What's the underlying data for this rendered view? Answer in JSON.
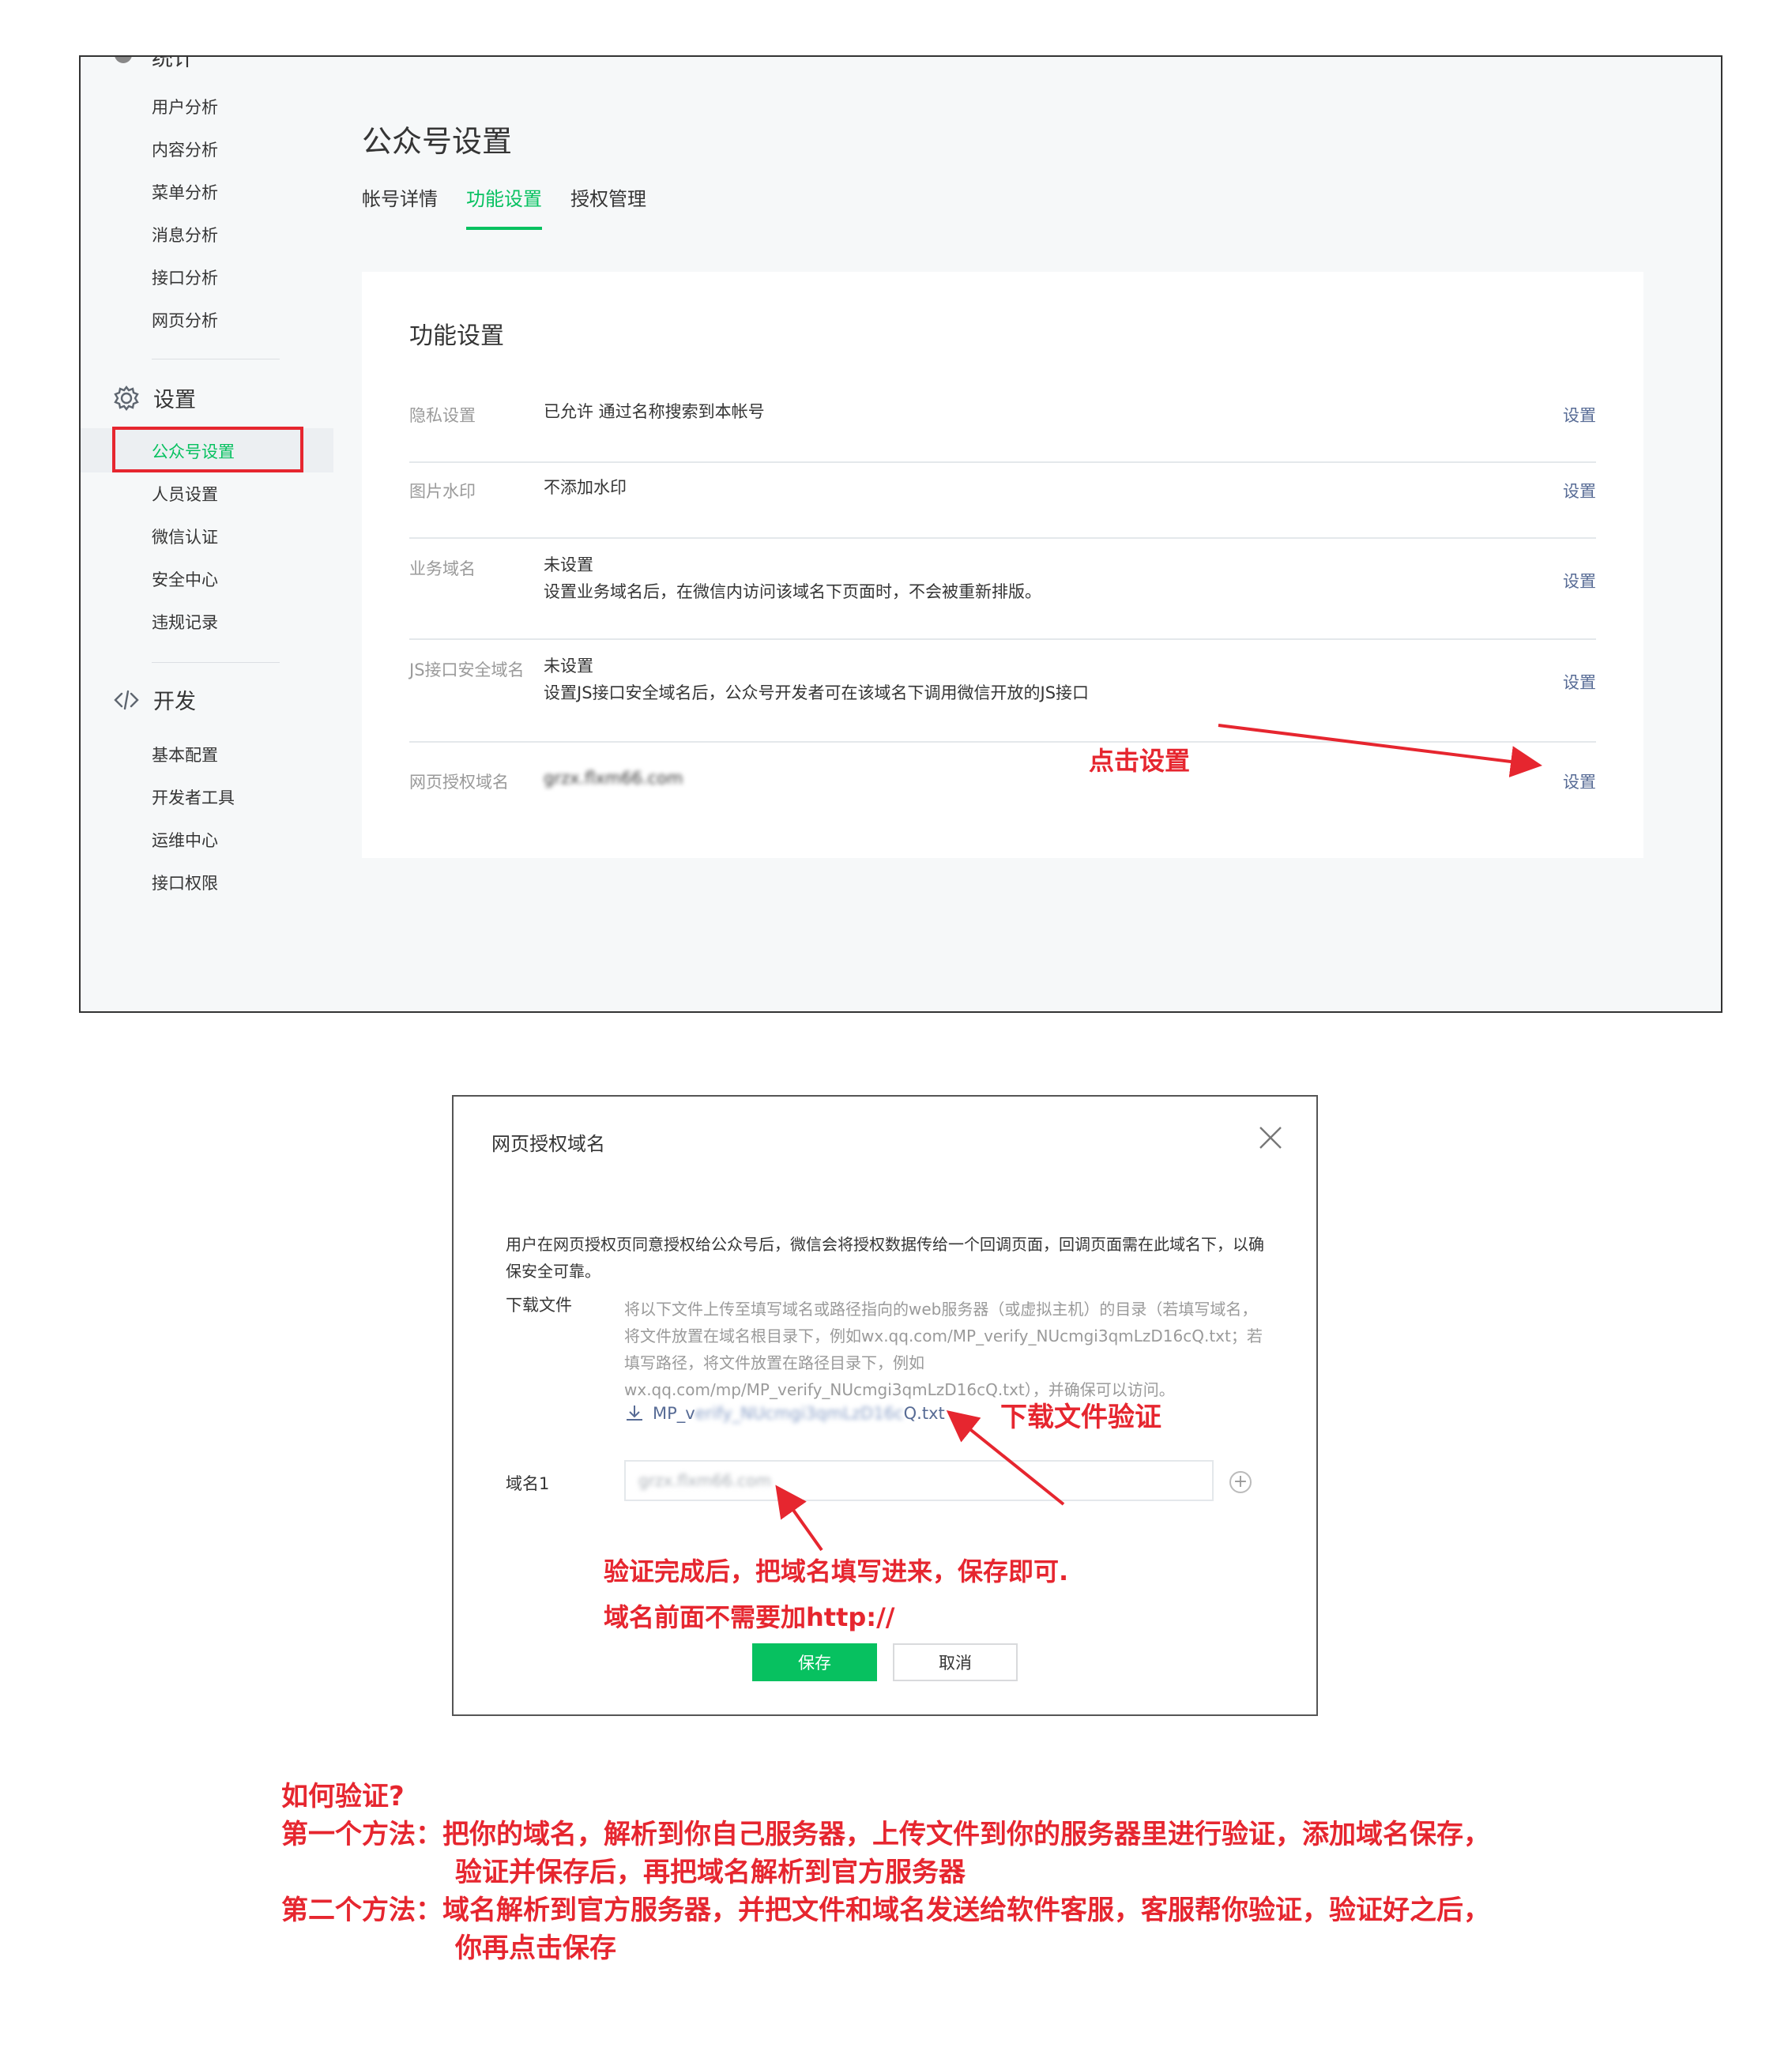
{
  "sidebar": {
    "cut_category": "统计",
    "stats_items": [
      "用户分析",
      "内容分析",
      "菜单分析",
      "消息分析",
      "接口分析",
      "网页分析"
    ],
    "settings_label": "设置",
    "settings_items": [
      "公众号设置",
      "人员设置",
      "微信认证",
      "安全中心",
      "违规记录"
    ],
    "dev_label": "开发",
    "dev_items": [
      "基本配置",
      "开发者工具",
      "运维中心",
      "接口权限"
    ]
  },
  "page": {
    "title": "公众号设置",
    "tabs": [
      "帐号详情",
      "功能设置",
      "授权管理"
    ],
    "active_tab": "功能设置"
  },
  "card": {
    "title": "功能设置",
    "rows": [
      {
        "label": "隐私设置",
        "value": "已允许 通过名称搜索到本帐号",
        "desc": "",
        "action": "设置"
      },
      {
        "label": "图片水印",
        "value": "不添加水印",
        "desc": "",
        "action": "设置"
      },
      {
        "label": "业务域名",
        "value": "未设置",
        "desc": "设置业务域名后，在微信内访问该域名下页面时，不会被重新排版。",
        "action": "设置"
      },
      {
        "label": "JS接口安全域名",
        "value": "未设置",
        "desc": "设置JS接口安全域名后，公众号开发者可在该域名下调用微信开放的JS接口",
        "action": "设置"
      },
      {
        "label": "网页授权域名",
        "value": "grzx.flxm66.com",
        "desc": "",
        "action": "设置"
      }
    ]
  },
  "annotations": {
    "click_setting": "点击设置",
    "download_verify": "下载文件验证",
    "after_verify_1": "验证完成后，把域名填写进来，保存即可.",
    "after_verify_2": "域名前面不需要加http://"
  },
  "dialog": {
    "title": "网页授权域名",
    "description": "用户在网页授权页同意授权给公众号后，微信会将授权数据传给一个回调页面，回调页面需在此域名下，以确保安全可靠。",
    "download_label": "下载文件",
    "download_note": "将以下文件上传至填写域名或路径指向的web服务器（或虚拟主机）的目录（若填写域名，将文件放置在域名根目录下，例如wx.qq.com/MP_verify_NUcmgi3qmLzD16cQ.txt；若填写路径，将文件放置在路径目录下，例如wx.qq.com/mp/MP_verify_NUcmgi3qmLzD16cQ.txt），并确保可以访问。",
    "file_prefix": "MP_v",
    "file_blurred": "erify_NUcmgi3qmLzD16c",
    "file_suffix": "Q.txt",
    "domain_label": "域名1",
    "domain_value": "grzx.flxm66.com",
    "save_label": "保存",
    "cancel_label": "取消"
  },
  "notes": {
    "q": "如何验证?",
    "m1_a": "第一个方法：把你的域名，解析到你自己服务器，上传文件到你的服务器里进行验证，添加域名保存，",
    "m1_b": "验证并保存后，再把域名解析到官方服务器",
    "m2_a": "第二个方法：域名解析到官方服务器，并把文件和域名发送给软件客服，客服帮你验证，验证好之后，",
    "m2_b": "你再点击保存"
  },
  "colors": {
    "accent": "#07c160",
    "annotation": "#e6262f",
    "link": "#576b95"
  },
  "icons": [
    "gear-icon",
    "code-icon",
    "close-icon",
    "download-icon",
    "plus-icon",
    "arrow-icon"
  ]
}
